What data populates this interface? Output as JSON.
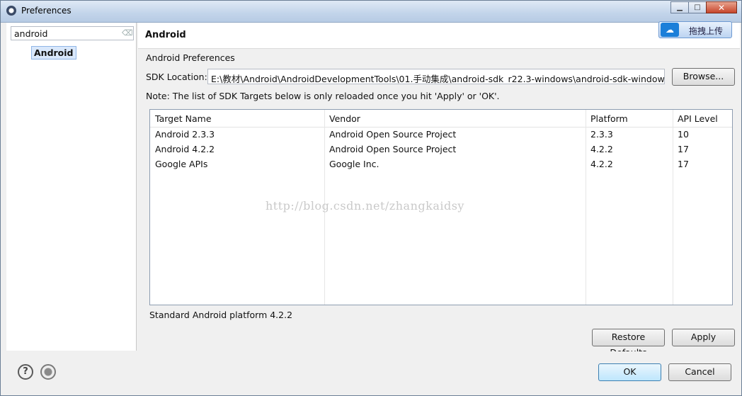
{
  "window": {
    "title": "Preferences"
  },
  "sidebar": {
    "filter_value": "android",
    "tree_items": [
      {
        "label": "Android"
      }
    ]
  },
  "page": {
    "title": "Android",
    "upload_button_label": "拖拽上传",
    "section_label": "Android Preferences",
    "sdk_location_label": "SDK Location:",
    "sdk_location_value": "E:\\教材\\Android\\AndroidDevelopmentTools\\01.手动集成\\android-sdk_r22.3-windows\\android-sdk-windows",
    "browse_label": "Browse...",
    "note": "Note: The list of SDK Targets below is only reloaded once you hit 'Apply' or 'OK'.",
    "table": {
      "columns": [
        "Target Name",
        "Vendor",
        "Platform",
        "API Level"
      ],
      "rows": [
        [
          "Android 2.3.3",
          "Android Open Source Project",
          "2.3.3",
          "10"
        ],
        [
          "Android 4.2.2",
          "Android Open Source Project",
          "4.2.2",
          "17"
        ],
        [
          "Google APIs",
          "Google Inc.",
          "4.2.2",
          "17"
        ]
      ]
    },
    "watermark": "http://blog.csdn.net/zhangkaidsy",
    "status_text": "Standard Android platform 4.2.2",
    "restore_defaults_label": "Restore Defaults",
    "apply_label": "Apply"
  },
  "footer": {
    "ok_label": "OK",
    "cancel_label": "Cancel"
  },
  "icons": {
    "app": "preferences-gear-icon",
    "help": "help-icon",
    "record": "record-icon",
    "upload": "cloud-icon"
  }
}
